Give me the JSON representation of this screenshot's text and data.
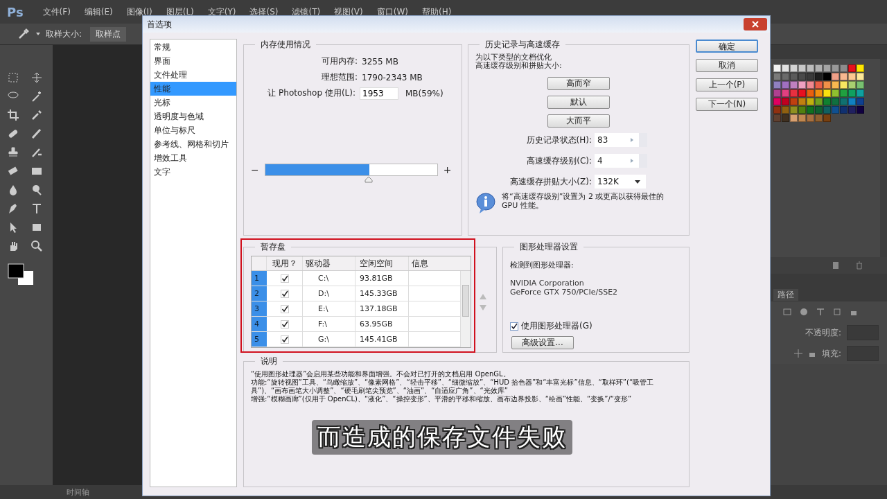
{
  "menubar": {
    "logo": "Ps",
    "items": [
      "文件(F)",
      "编辑(E)",
      "图像(I)",
      "图层(L)",
      "文字(Y)",
      "选择(S)",
      "滤镜(T)",
      "视图(V)",
      "窗口(W)",
      "帮助(H)"
    ]
  },
  "options_bar": {
    "label": "取样大小:",
    "value": "取样点"
  },
  "swatches": [
    {
      "color": "#f2f2f2"
    },
    {
      "color": "#e0e0e0"
    },
    {
      "color": "#d4d4d4"
    },
    {
      "color": "#c8c8c8"
    },
    {
      "color": "#bcbcbc"
    },
    {
      "color": "#b0b0b0"
    },
    {
      "color": "#a4a4a4"
    },
    {
      "color": "#989898"
    },
    {
      "color": "#8c8c8c"
    },
    {
      "color": "#e8101c"
    },
    {
      "color": "#ffe600"
    },
    {
      "color": "#7a7a7a"
    },
    {
      "color": "#6a6a6a"
    },
    {
      "color": "#5a5a5a"
    },
    {
      "color": "#4a4a4a"
    },
    {
      "color": "#3a3a3a"
    },
    {
      "color": "#1e1e1e"
    },
    {
      "color": "#000000"
    },
    {
      "color": "#f0a088"
    },
    {
      "color": "#f8b890"
    },
    {
      "color": "#fcc890"
    },
    {
      "color": "#fce898"
    },
    {
      "color": "#9080c0"
    },
    {
      "color": "#a070c0"
    },
    {
      "color": "#c080c0"
    },
    {
      "color": "#f0a0c0"
    },
    {
      "color": "#f08890"
    },
    {
      "color": "#e86048"
    },
    {
      "color": "#f09048"
    },
    {
      "color": "#f8b850"
    },
    {
      "color": "#f8e860"
    },
    {
      "color": "#a8d070"
    },
    {
      "color": "#78c070"
    },
    {
      "color": "#b04090"
    },
    {
      "color": "#e04080"
    },
    {
      "color": "#e83040"
    },
    {
      "color": "#e81020"
    },
    {
      "color": "#e86010"
    },
    {
      "color": "#f09010"
    },
    {
      "color": "#f8e010"
    },
    {
      "color": "#90c030"
    },
    {
      "color": "#20a040"
    },
    {
      "color": "#10a060"
    },
    {
      "color": "#10a0a0"
    },
    {
      "color": "#e00060"
    },
    {
      "color": "#c00020"
    },
    {
      "color": "#c04010"
    },
    {
      "color": "#c08010"
    },
    {
      "color": "#c0b010"
    },
    {
      "color": "#70a020"
    },
    {
      "color": "#108030"
    },
    {
      "color": "#107040"
    },
    {
      "color": "#107070"
    },
    {
      "color": "#1080c0"
    },
    {
      "color": "#104090"
    },
    {
      "color": "#903010"
    },
    {
      "color": "#906010"
    },
    {
      "color": "#909020"
    },
    {
      "color": "#508010"
    },
    {
      "color": "#107020"
    },
    {
      "color": "#106030"
    },
    {
      "color": "#106060"
    },
    {
      "color": "#105090"
    },
    {
      "color": "#103070"
    },
    {
      "color": "#202060"
    },
    {
      "color": "#100040"
    },
    {
      "color": "#604030"
    },
    {
      "color": "#403020"
    },
    {
      "color": "#d8a070"
    },
    {
      "color": "#c08850"
    },
    {
      "color": "#a87040"
    },
    {
      "color": "#906030"
    },
    {
      "color": "#784010"
    }
  ],
  "layers_panel": {
    "tab": "路径",
    "opacity_label": "不透明度:",
    "fill_label": "填充:"
  },
  "timeline_tab": "时间轴",
  "dialog": {
    "title": "首选项",
    "categories": [
      {
        "label": "常规",
        "selected": false
      },
      {
        "label": "界面",
        "selected": false
      },
      {
        "label": "文件处理",
        "selected": false
      },
      {
        "label": "性能",
        "selected": true
      },
      {
        "label": "光标",
        "selected": false
      },
      {
        "label": "透明度与色域",
        "selected": false
      },
      {
        "label": "单位与标尺",
        "selected": false
      },
      {
        "label": "参考线、网格和切片",
        "selected": false
      },
      {
        "label": "增效工具",
        "selected": false
      },
      {
        "label": "文字",
        "selected": false
      }
    ],
    "memory": {
      "title": "内存使用情况",
      "available_label": "可用内存:",
      "available": "3255 MB",
      "ideal_label": "理想范围:",
      "ideal": "1790-2343 MB",
      "use_label": "让 Photoshop 使用(L):",
      "use_value": "1953",
      "use_percent": "MB(59%)",
      "minus": "−",
      "plus": "+",
      "level": 0.6
    },
    "history": {
      "title": "历史记录与高速缓存",
      "intro": [
        "为以下类型的文档优化",
        "高速缓存级别和拼贴大小:"
      ],
      "presets": [
        "高而窄",
        "默认",
        "大而平"
      ],
      "fields": [
        {
          "kind": "stepper",
          "label": "历史记录状态(H):",
          "value": "83"
        },
        {
          "kind": "stepper",
          "label": "高速缓存级别(C):",
          "value": "4"
        },
        {
          "kind": "dropdown",
          "label": "高速缓存拼贴大小(Z):",
          "value": "132K"
        }
      ],
      "info": "将“高速缓存级别”设置为 2 或更高以获得最佳的 GPU 性能。"
    },
    "scratch": {
      "title": "暂存盘",
      "highlighted": true,
      "columns": [
        "现用？",
        "驱动器",
        "空闲空间",
        "信息"
      ],
      "rows": [
        {
          "num": "1",
          "active": true,
          "drive": "C:\\",
          "free": "93.81GB"
        },
        {
          "num": "2",
          "active": true,
          "drive": "D:\\",
          "free": "145.33GB"
        },
        {
          "num": "3",
          "active": true,
          "drive": "E:\\",
          "free": "137.18GB"
        },
        {
          "num": "4",
          "active": true,
          "drive": "F:\\",
          "free": "63.95GB"
        },
        {
          "num": "5",
          "active": true,
          "drive": "G:\\",
          "free": "145.41GB"
        }
      ]
    },
    "gpu": {
      "title": "图形处理器设置",
      "detected_label": "检测到图形处理器:",
      "name_lines": [
        "NVIDIA Corporation",
        "GeForce GTX 750/PCIe/SSE2"
      ],
      "use_label": "使用图形处理器(G)",
      "use_checked": true,
      "advanced": "高级设置..."
    },
    "description": {
      "title": "说明",
      "lines": [
        "“使用图形处理器”会启用某些功能和界面增强。不会对已打开的文档启用 OpenGL。",
        "功能:“旋转视图”工具、“鸟瞰缩放”、“像素网格”、“轻击平移”、“细微缩放”、“HUD 拾色器”和“丰富光标”信息、“取样环”(“吸管工具”)、“画布画笔大小调整”、“硬毛刷笔尖预览”、“油画”、“自适应广角”、“光效库”",
        "增强:“模糊画廊”(仅用于 OpenCL)、“液化”、“操控变形”、平滑的平移和缩放、画布边界投影、“绘画”性能、“变换”/“变形”"
      ]
    },
    "buttons": [
      {
        "label": "确定",
        "default": true
      },
      {
        "label": "取消",
        "default": false
      },
      {
        "label": "上一个(P)",
        "default": false
      },
      {
        "label": "下一个(N)",
        "default": false
      }
    ]
  },
  "subtitle": "而造成的保存文件失败"
}
